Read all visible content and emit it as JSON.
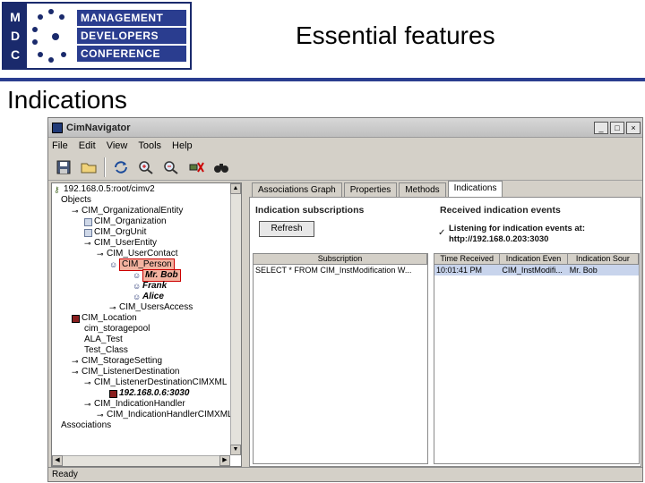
{
  "slide": {
    "title": "Essential features",
    "subtitle": "Indications",
    "logo": {
      "letters": [
        "M",
        "D",
        "C"
      ],
      "lines": [
        "MANAGEMENT",
        "DEVELOPERS",
        "CONFERENCE"
      ]
    },
    "colors": {
      "brand": "#2a3d8f"
    }
  },
  "window": {
    "title": "CimNavigator",
    "controls": [
      "_",
      "□",
      "×"
    ],
    "menu": [
      "File",
      "Edit",
      "View",
      "Tools",
      "Help"
    ],
    "toolbar_icons": [
      "save-icon",
      "open-folder-icon",
      "refresh-icon",
      "zoom-in-icon",
      "zoom-out-icon",
      "disconnect-icon",
      "binoculars-icon"
    ],
    "status": "Ready"
  },
  "tree": [
    {
      "label": "192.168.0.5:root/cimv2",
      "icon": "key-icon"
    },
    {
      "label": "Objects"
    },
    {
      "label": "CIM_OrganizationalEntity"
    },
    {
      "label": "CIM_Organization"
    },
    {
      "label": "CIM_OrgUnit"
    },
    {
      "label": "CIM_UserEntity"
    },
    {
      "label": "CIM_UserContact"
    },
    {
      "label": "CIM_Person"
    },
    {
      "label": "Mr. Bob"
    },
    {
      "label": "Frank"
    },
    {
      "label": "Alice"
    },
    {
      "label": "CIM_UsersAccess"
    },
    {
      "label": "CIM_Location"
    },
    {
      "label": "cim_storagepool"
    },
    {
      "label": "ALA_Test"
    },
    {
      "label": "Test_Class"
    },
    {
      "label": "CIM_StorageSetting"
    },
    {
      "label": "CIM_ListenerDestination"
    },
    {
      "label": "CIM_ListenerDestinationCIMXML"
    },
    {
      "label": "192.168.0.6:3030"
    },
    {
      "label": "CIM_IndicationHandler"
    },
    {
      "label": "CIM_IndicationHandlerCIMXML"
    },
    {
      "label": "Associations"
    }
  ],
  "tabs": [
    "Associations Graph",
    "Properties",
    "Methods",
    "Indications"
  ],
  "indications": {
    "subscriptions_title": "Indication subscriptions",
    "received_title": "Received indication events",
    "refresh_label": "Refresh",
    "listening_line1": "Listening for indication events at:",
    "listening_line2": "http://192.168.0.203:3030",
    "subscriptions_table": {
      "columns": [
        "Subscription"
      ],
      "rows": [
        [
          "SELECT * FROM CIM_InstModification W..."
        ]
      ]
    },
    "events_table": {
      "columns": [
        "Time Received",
        "Indication Even",
        "Indication Sour"
      ],
      "rows": [
        [
          "10:01:41 PM",
          "CIM_InstModifi...",
          "Mr. Bob"
        ]
      ]
    }
  }
}
